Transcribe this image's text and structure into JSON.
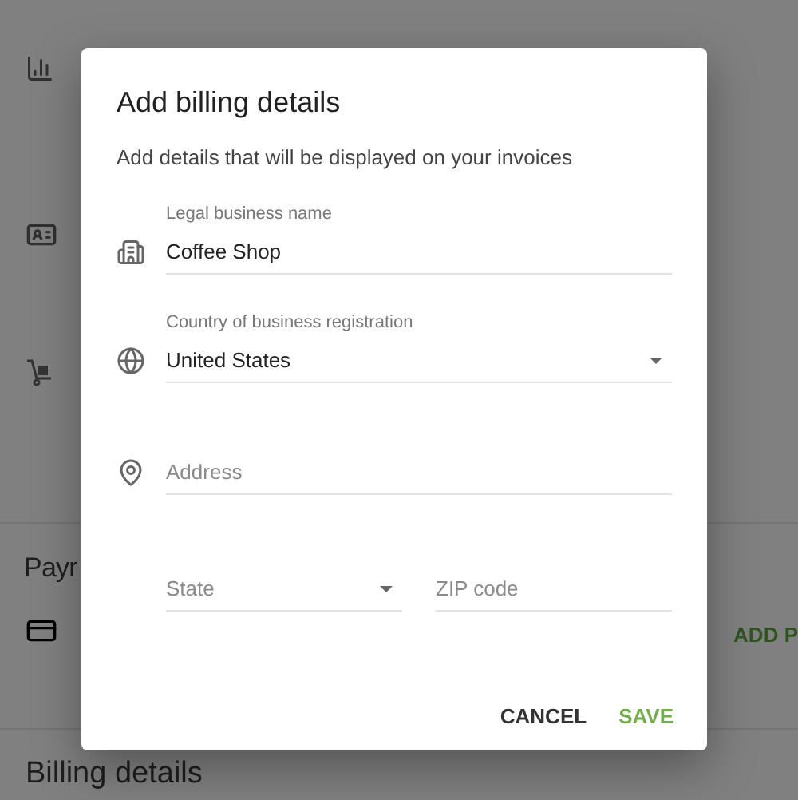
{
  "page": {
    "payments_heading": "Payr",
    "add_button": "ADD P",
    "billing_heading": "Billing details"
  },
  "dialog": {
    "title": "Add billing details",
    "subtitle": "Add details that will be displayed on your invoices",
    "fields": [
      {
        "kind": "text",
        "label": "Legal business name",
        "value": "Coffee Shop"
      },
      {
        "kind": "select",
        "label": "Country of business registration",
        "value": "United States"
      },
      {
        "kind": "text",
        "placeholder": "Address"
      }
    ],
    "row": [
      {
        "kind": "select",
        "placeholder": "State"
      },
      {
        "kind": "text",
        "placeholder": "ZIP code"
      }
    ],
    "buttons": [
      {
        "label": "CANCEL",
        "primary": false
      },
      {
        "label": "SAVE",
        "primary": true
      }
    ]
  }
}
